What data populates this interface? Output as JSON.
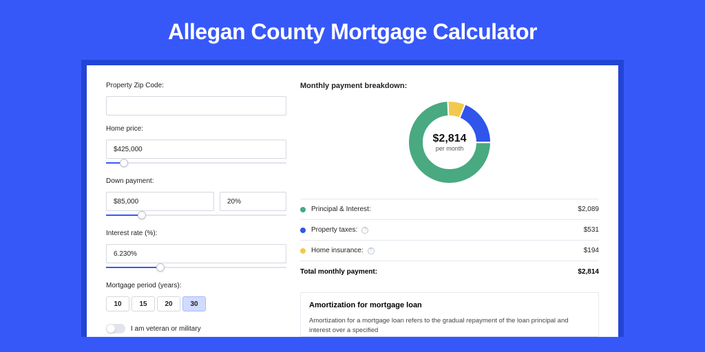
{
  "title": "Allegan County Mortgage Calculator",
  "form": {
    "zip_label": "Property Zip Code:",
    "zip_value": "",
    "home_price_label": "Home price:",
    "home_price_value": "$425,000",
    "home_price_slider_pct": 10,
    "down_payment_label": "Down payment:",
    "down_payment_value": "$85,000",
    "down_payment_pct": "20%",
    "down_payment_slider_pct": 20,
    "interest_label": "Interest rate (%):",
    "interest_value": "6.230%",
    "interest_slider_pct": 30,
    "period_label": "Mortgage period (years):",
    "period_options": [
      "10",
      "15",
      "20",
      "30"
    ],
    "period_active": "30",
    "veteran_label": "I am veteran or military"
  },
  "breakdown": {
    "title": "Monthly payment breakdown:",
    "total_amount": "$2,814",
    "per_month": "per month",
    "segments": [
      {
        "name": "yellow",
        "color": "#f2c94c"
      },
      {
        "name": "blue",
        "color": "#2f55eb"
      },
      {
        "name": "green",
        "color": "#49a981"
      }
    ],
    "items": [
      {
        "label": "Principal & Interest:",
        "value": "$2,089",
        "color": "#49a981",
        "info": false
      },
      {
        "label": "Property taxes:",
        "value": "$531",
        "color": "#2f55eb",
        "info": true
      },
      {
        "label": "Home insurance:",
        "value": "$194",
        "color": "#f2c94c",
        "info": true
      }
    ],
    "total_label": "Total monthly payment:",
    "total_value": "$2,814"
  },
  "amort": {
    "title": "Amortization for mortgage loan",
    "text": "Amortization for a mortgage loan refers to the gradual repayment of the loan principal and interest over a specified"
  },
  "chart_data": {
    "type": "pie",
    "title": "Monthly payment breakdown",
    "series": [
      {
        "name": "Principal & Interest",
        "value": 2089,
        "color": "#49a981"
      },
      {
        "name": "Property taxes",
        "value": 531,
        "color": "#2f55eb"
      },
      {
        "name": "Home insurance",
        "value": 194,
        "color": "#f2c94c"
      }
    ],
    "total": 2814,
    "unit": "USD/month"
  }
}
